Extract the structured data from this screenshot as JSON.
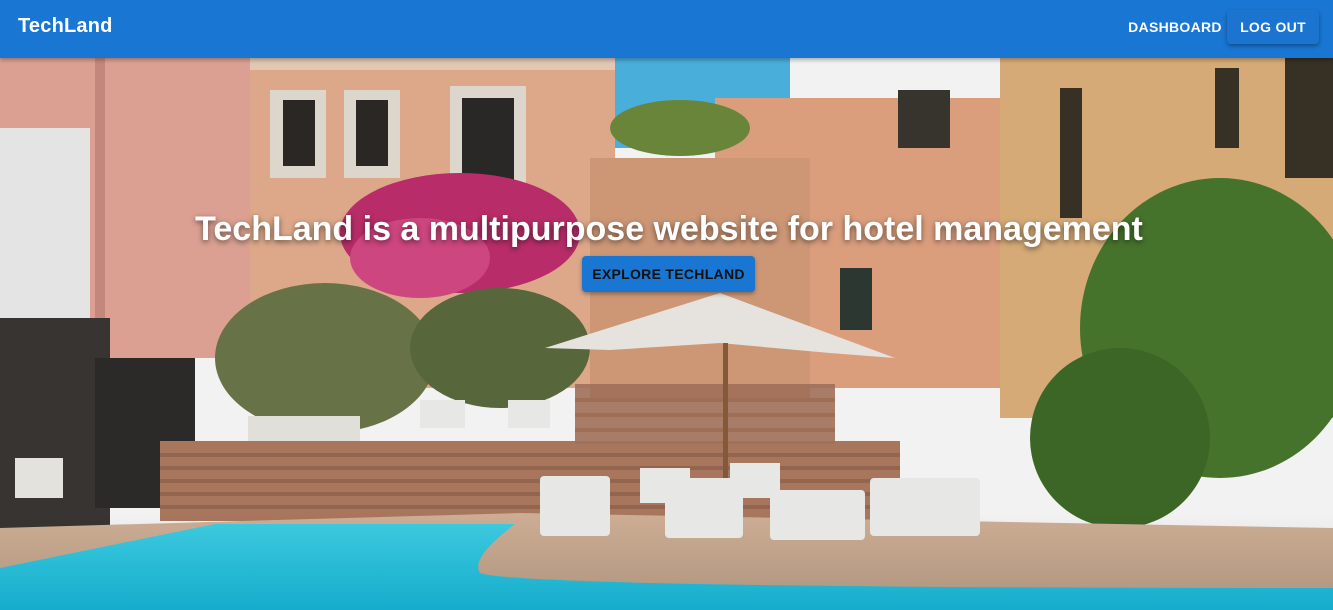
{
  "appbar": {
    "brand": "TechLand",
    "nav": {
      "dashboard": "DASHBOARD",
      "logout": "LOG OUT"
    }
  },
  "hero": {
    "headline": "TechLand is a multipurpose website for hotel management",
    "cta": "EXPLORE TECHLAND"
  },
  "colors": {
    "primary": "#1976d2",
    "pool": "#2fc7e3",
    "sky": "#4fb8e6",
    "wall": "#e6ad8e"
  }
}
